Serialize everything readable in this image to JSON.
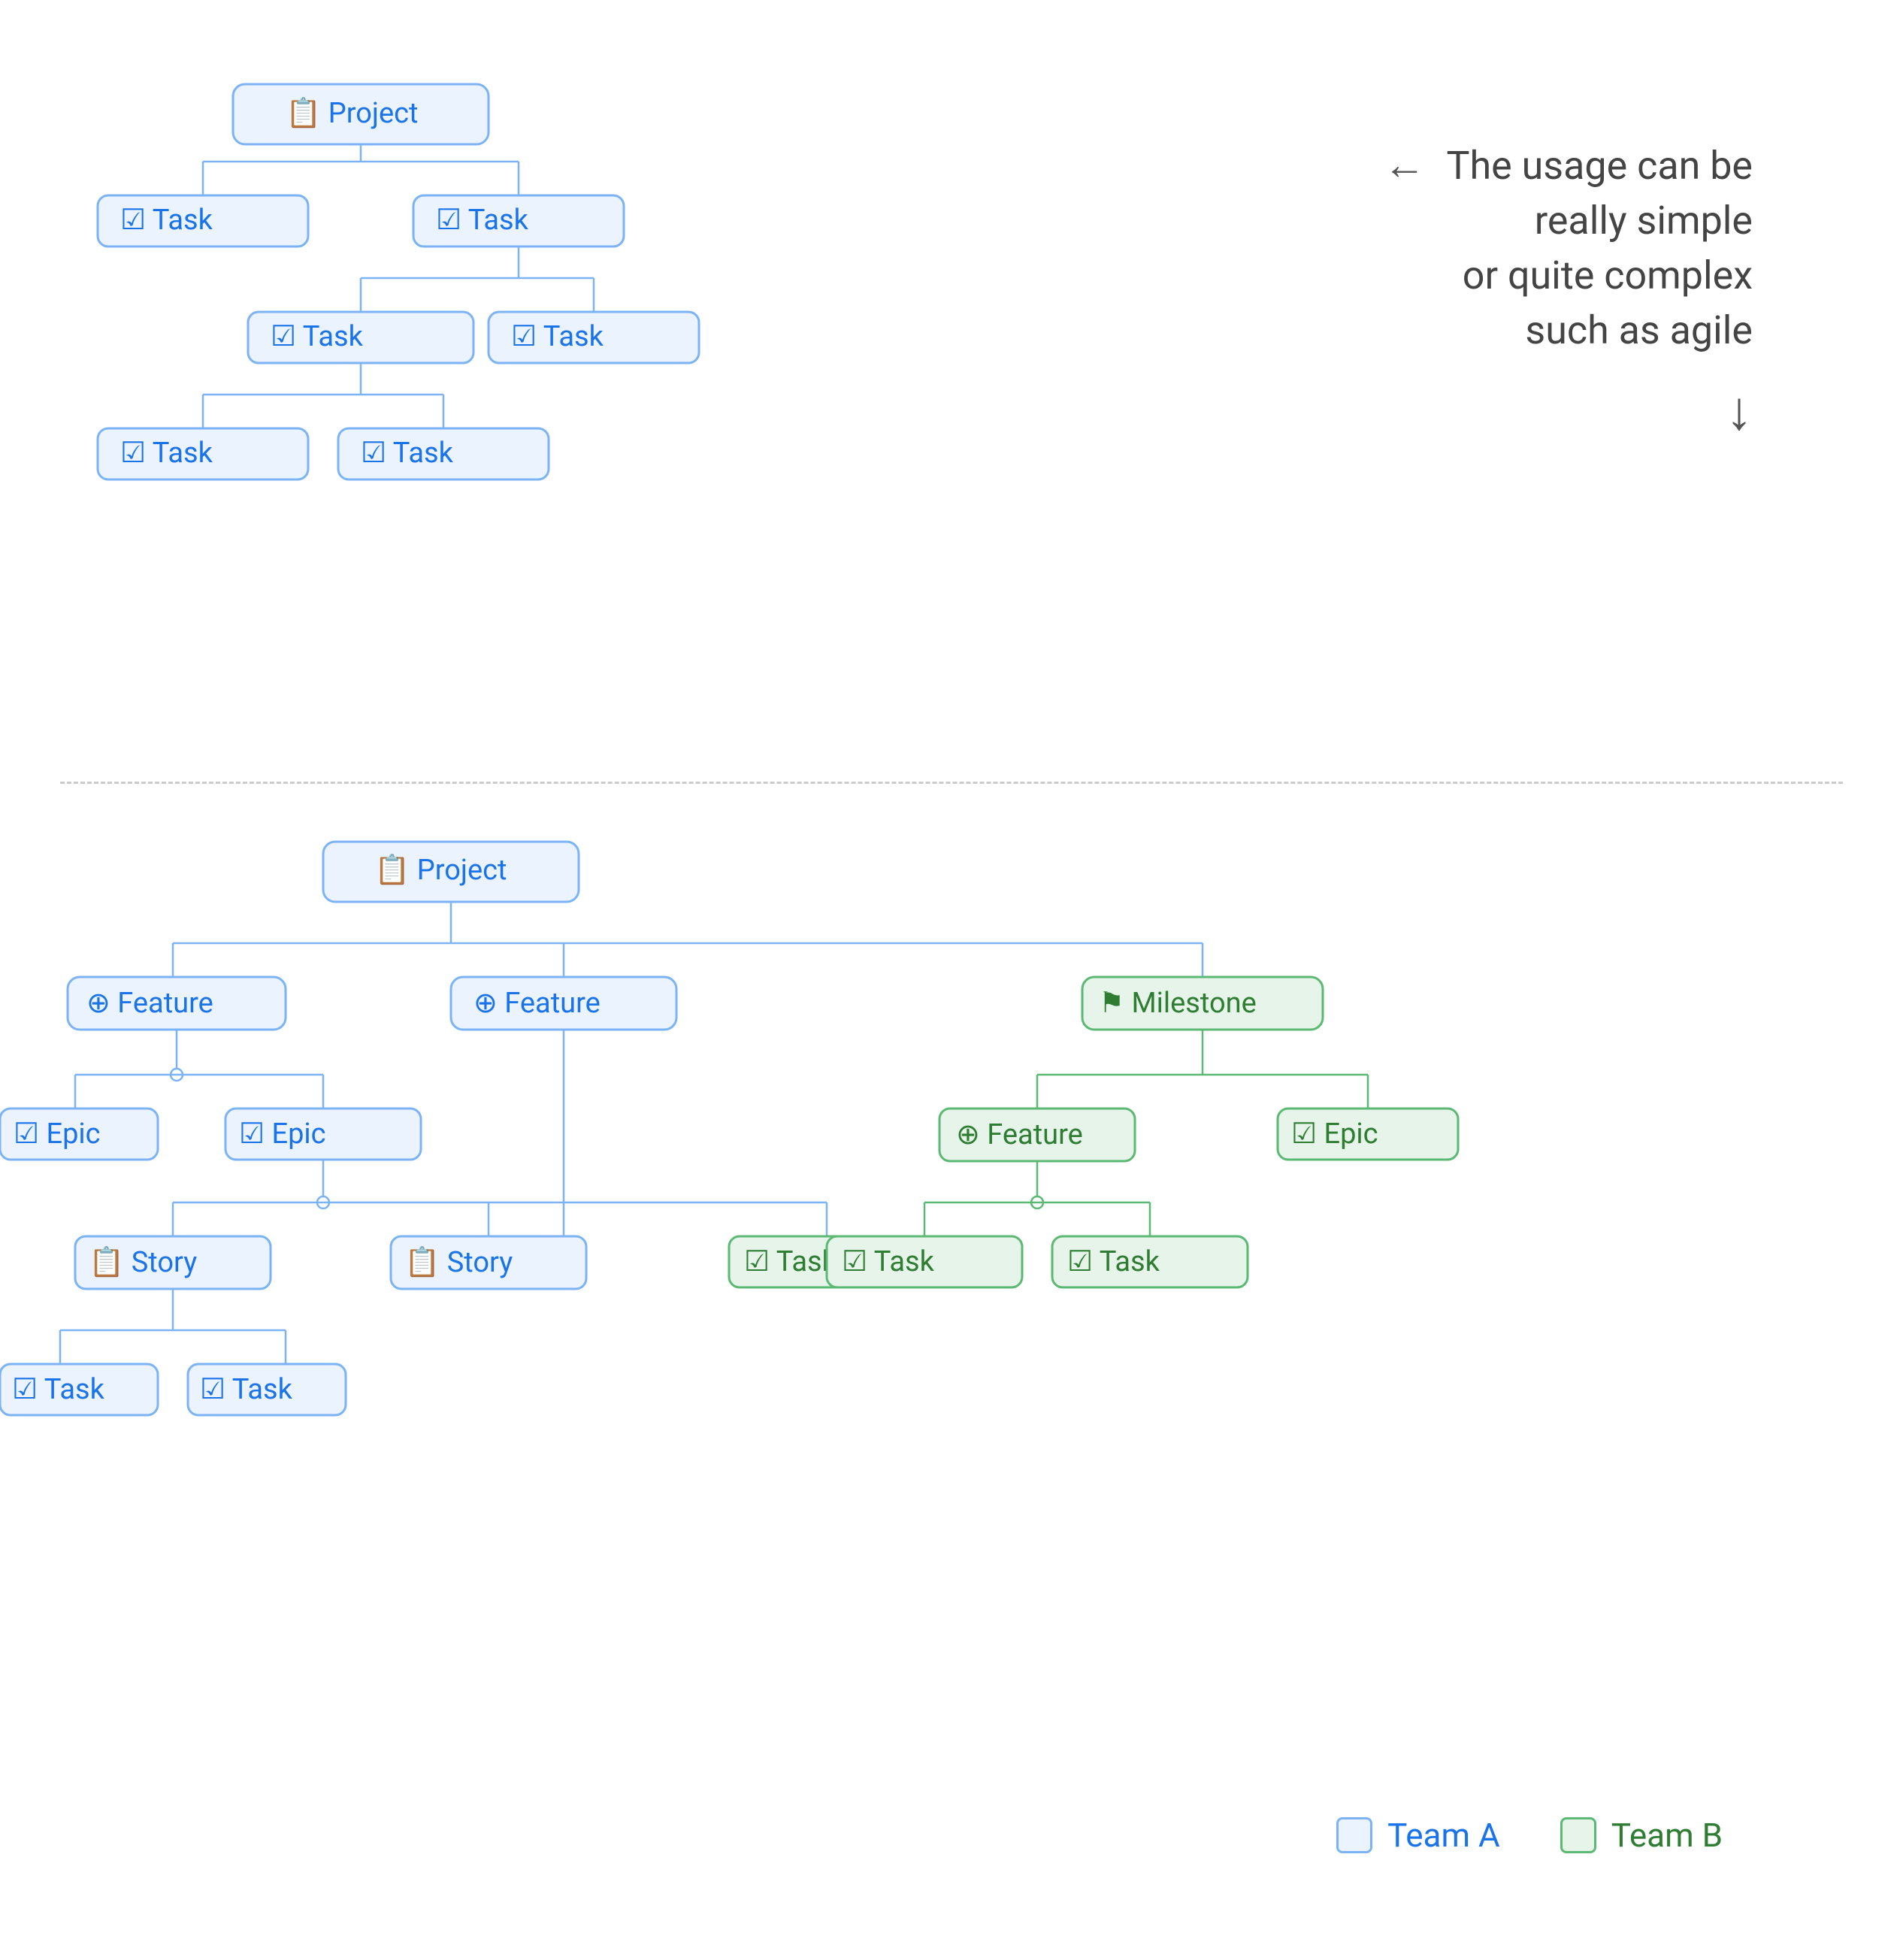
{
  "annotation": {
    "line1": "The usage can be",
    "line2": "really simple",
    "line3": "or quite complex",
    "line4": "such as agile"
  },
  "legend": {
    "team_a": "Team A",
    "team_b": "Team B"
  },
  "nodes": {
    "project": "Project",
    "task": "Task",
    "feature": "Feature",
    "epic": "Epic",
    "story": "Story",
    "milestone": "Milestone"
  }
}
